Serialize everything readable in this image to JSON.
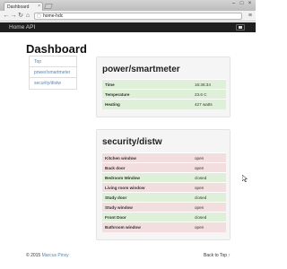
{
  "browser": {
    "tab_title": "Dashboard",
    "tab_close": "×",
    "url": "home-hdc",
    "window_controls": [
      "–",
      "□",
      "×"
    ],
    "nav_icons": [
      "back-arrow-icon",
      "forward-arrow-icon",
      "reload-icon",
      "home-icon"
    ],
    "nav_glyphs": [
      "←",
      "→",
      "↻",
      "⌂"
    ]
  },
  "navbar": {
    "brand": "Home API"
  },
  "page": {
    "title": "Dashboard"
  },
  "sidebar": {
    "items": [
      {
        "label": "Top"
      },
      {
        "label": "power/smartmeter"
      },
      {
        "label": "security/distw"
      }
    ]
  },
  "power": {
    "title": "power/smartmeter",
    "rows": [
      {
        "key": "Time",
        "value": "16:36:34",
        "status": "success"
      },
      {
        "key": "Temperature",
        "value": "23.6 C",
        "status": "success"
      },
      {
        "key": "Heating",
        "value": "427 watts",
        "status": "success"
      }
    ]
  },
  "security": {
    "title": "security/distw",
    "rows": [
      {
        "key": "Kitchen window",
        "value": "open",
        "status": "danger"
      },
      {
        "key": "Back door",
        "value": "open",
        "status": "danger"
      },
      {
        "key": "Bedroom Window",
        "value": "closed",
        "status": "success"
      },
      {
        "key": "Living room window",
        "value": "open",
        "status": "danger"
      },
      {
        "key": "Study door",
        "value": "closed",
        "status": "success"
      },
      {
        "key": "Study window",
        "value": "open",
        "status": "danger"
      },
      {
        "key": "Front Door",
        "value": "closed",
        "status": "success"
      },
      {
        "key": "Bathroom window",
        "value": "open",
        "status": "danger"
      }
    ]
  },
  "footer": {
    "copyright": "© 2015",
    "author": "Marcus Pinxy",
    "back_to_top": "Back to Top",
    "back_to_top_arrow": "↑"
  },
  "colors": {
    "success": "#dff0d8",
    "danger": "#f2dede",
    "link": "#428bca",
    "navbar": "#1f1f1f"
  }
}
